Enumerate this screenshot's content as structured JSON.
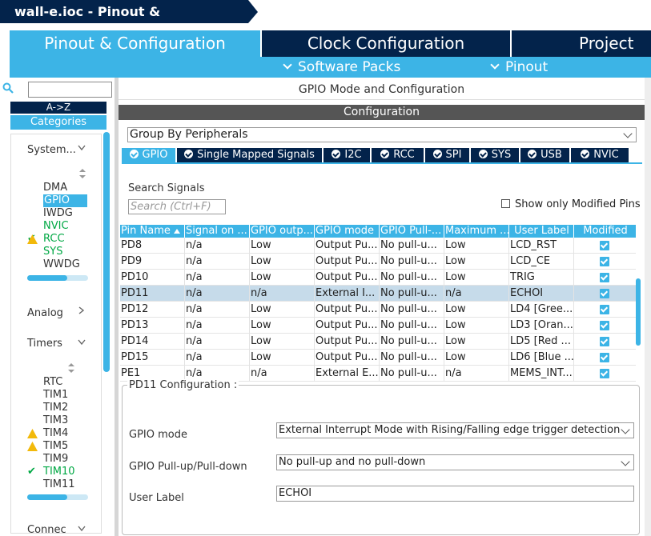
{
  "window": {
    "title": "wall-e.ioc - Pinout & Configuration"
  },
  "top_tabs": [
    {
      "label": "Pinout & Configuration",
      "active": true
    },
    {
      "label": "Clock Configuration",
      "active": false
    },
    {
      "label": "Project Ma",
      "active": false
    }
  ],
  "sub_menu": {
    "software_packs": "Software Packs",
    "pinout": "Pinout"
  },
  "left_panel": {
    "sort_button": "A->Z",
    "categories_tab": "Categories",
    "groups": [
      {
        "label": "System...",
        "expanded": true
      },
      {
        "label": "Analog",
        "expanded": false
      },
      {
        "label": "Timers",
        "expanded": true
      },
      {
        "label": "Connec",
        "expanded": true
      }
    ],
    "system_items": [
      {
        "label": "DMA",
        "status": "none"
      },
      {
        "label": "GPIO",
        "status": "selected"
      },
      {
        "label": "IWDG",
        "status": "none"
      },
      {
        "label": "NVIC",
        "status": "green"
      },
      {
        "label": "RCC",
        "status": "ok"
      },
      {
        "label": "SYS",
        "status": "warning"
      },
      {
        "label": "WWDG",
        "status": "none"
      }
    ],
    "timer_items": [
      {
        "label": "RTC",
        "status": "none"
      },
      {
        "label": "TIM1",
        "status": "none"
      },
      {
        "label": "TIM2",
        "status": "none"
      },
      {
        "label": "TIM3",
        "status": "none"
      },
      {
        "label": "TIM4",
        "status": "warning"
      },
      {
        "label": "TIM5",
        "status": "warning"
      },
      {
        "label": "TIM9",
        "status": "none"
      },
      {
        "label": "TIM10",
        "status": "ok"
      },
      {
        "label": "TIM11",
        "status": "none"
      }
    ]
  },
  "main": {
    "header": "GPIO Mode and Configuration",
    "config_bar": "Configuration",
    "group_by": "Group By Peripherals",
    "peripheral_tabs": [
      "GPIO",
      "Single Mapped Signals",
      "I2C",
      "RCC",
      "SPI",
      "SYS",
      "USB",
      "NVIC"
    ],
    "search_label": "Search Signals",
    "search_placeholder": "Search (Ctrl+F)",
    "show_modified": "Show only Modified Pins",
    "columns": [
      "Pin Name",
      "Signal on ...",
      "GPIO outp...",
      "GPIO mode",
      "GPIO Pull-...",
      "Maximum ...",
      "User Label",
      "Modified"
    ],
    "rows": [
      {
        "pin": "PD8",
        "signal": "n/a",
        "output": "Low",
        "mode": "Output Pu...",
        "pull": "No pull-u...",
        "speed": "Low",
        "label": "LCD_RST",
        "modified": true,
        "selected": false
      },
      {
        "pin": "PD9",
        "signal": "n/a",
        "output": "Low",
        "mode": "Output Pu...",
        "pull": "No pull-u...",
        "speed": "Low",
        "label": "LCD_CE",
        "modified": true,
        "selected": false
      },
      {
        "pin": "PD10",
        "signal": "n/a",
        "output": "Low",
        "mode": "Output Pu...",
        "pull": "No pull-u...",
        "speed": "Low",
        "label": "TRIG",
        "modified": true,
        "selected": false
      },
      {
        "pin": "PD11",
        "signal": "n/a",
        "output": "n/a",
        "mode": "External I...",
        "pull": "No pull-u...",
        "speed": "n/a",
        "label": "ECHOI",
        "modified": true,
        "selected": true
      },
      {
        "pin": "PD12",
        "signal": "n/a",
        "output": "Low",
        "mode": "Output Pu...",
        "pull": "No pull-u...",
        "speed": "Low",
        "label": "LD4 [Gree...",
        "modified": true,
        "selected": false
      },
      {
        "pin": "PD13",
        "signal": "n/a",
        "output": "Low",
        "mode": "Output Pu...",
        "pull": "No pull-u...",
        "speed": "Low",
        "label": "LD3 [Oran...",
        "modified": true,
        "selected": false
      },
      {
        "pin": "PD14",
        "signal": "n/a",
        "output": "Low",
        "mode": "Output Pu...",
        "pull": "No pull-u...",
        "speed": "Low",
        "label": "LD5 [Red ...",
        "modified": true,
        "selected": false
      },
      {
        "pin": "PD15",
        "signal": "n/a",
        "output": "Low",
        "mode": "Output Pu...",
        "pull": "No pull-u...",
        "speed": "Low",
        "label": "LD6 [Blue ...",
        "modified": true,
        "selected": false
      },
      {
        "pin": "PE1",
        "signal": "n/a",
        "output": "n/a",
        "mode": "External E...",
        "pull": "No pull-u...",
        "speed": "n/a",
        "label": "MEMS_INT...",
        "modified": true,
        "selected": false
      }
    ],
    "pin_config": {
      "title": "PD11 Configuration :",
      "gpio_mode_label": "GPIO mode",
      "gpio_mode_value": "External Interrupt Mode with Rising/Falling edge trigger detection",
      "pull_label": "GPIO Pull-up/Pull-down",
      "pull_value": "No pull-up and no pull-down",
      "user_label_label": "User Label",
      "user_label_value": "ECHOI"
    }
  },
  "colors": {
    "accent": "#3cb4e6",
    "navy": "#03234b",
    "ok_green": "#00a844",
    "warning": "#f2b90b",
    "selected_row": "#c6dbea"
  }
}
